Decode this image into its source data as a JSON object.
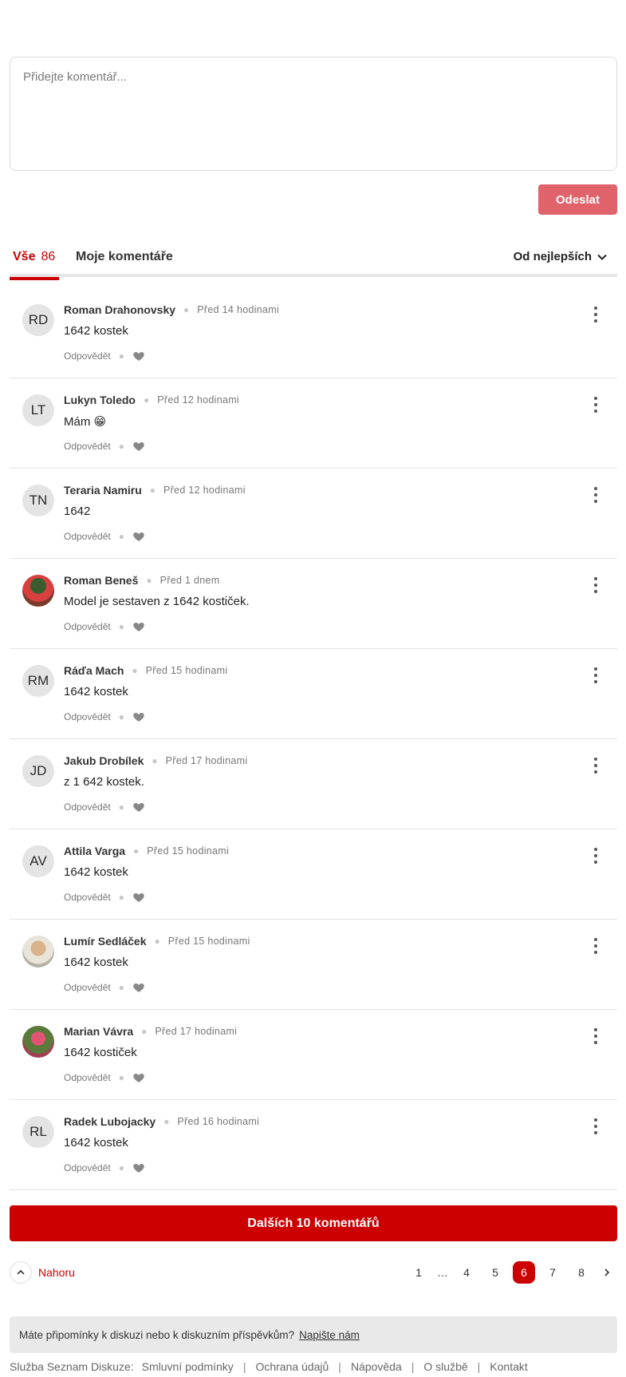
{
  "composer": {
    "placeholder": "Přidejte komentář..."
  },
  "send_label": "Odeslat",
  "tabs": {
    "all_label": "Vše",
    "all_count": "86",
    "mine_label": "Moje komentáře",
    "sort_label": "Od nejlepších"
  },
  "comments": [
    {
      "initials": "RD",
      "name": "Roman Drahonovsky",
      "time": "Před 14 hodinami",
      "text": "1642 kostek",
      "reply": "Odpovědět"
    },
    {
      "initials": "LT",
      "name": "Lukyn Toledo",
      "time": "Před 12 hodinami",
      "text": "Mám 😁",
      "reply": "Odpovědět"
    },
    {
      "initials": "TN",
      "name": "Teraria Namiru",
      "time": "Před 12 hodinami",
      "text": "1642",
      "reply": "Odpovědět"
    },
    {
      "initials": "",
      "name": "Roman Beneš",
      "time": "Před 1 dnem",
      "text": "Model je sestaven z 1642 kostiček.",
      "reply": "Odpovědět"
    },
    {
      "initials": "RM",
      "name": "Ráďa Mach",
      "time": "Před 15 hodinami",
      "text": "1642 kostek",
      "reply": "Odpovědět"
    },
    {
      "initials": "JD",
      "name": "Jakub Drobílek",
      "time": "Před 17 hodinami",
      "text": "z 1 642 kostek.",
      "reply": "Odpovědět"
    },
    {
      "initials": "AV",
      "name": "Attila Varga",
      "time": "Před 15 hodinami",
      "text": "1642 kostek",
      "reply": "Odpovědět"
    },
    {
      "initials": "",
      "name": "Lumír Sedláček",
      "time": "Před 15 hodinami",
      "text": "1642 kostek",
      "reply": "Odpovědět"
    },
    {
      "initials": "",
      "name": "Marian Vávra",
      "time": "Před 17 hodinami",
      "text": "1642 kostiček",
      "reply": "Odpovědět"
    },
    {
      "initials": "RL",
      "name": "Radek Lubojacky",
      "time": "Před 16 hodinami",
      "text": "1642 kostek",
      "reply": "Odpovědět"
    }
  ],
  "load_more_label": "Dalších 10 komentářů",
  "to_top_label": "Nahoru",
  "pagination": {
    "pages": [
      "1",
      "…",
      "4",
      "5",
      "6",
      "7",
      "8"
    ],
    "current": "6"
  },
  "feedback": {
    "text": "Máte připomínky k diskuzi nebo k diskuzním příspěvkům?",
    "link": "Napište nám"
  },
  "footer": {
    "service_label": "Služba Seznam Diskuze:",
    "links": [
      "Smluvní podmínky",
      "Ochrana údajů",
      "Nápověda",
      "O službě",
      "Kontakt"
    ]
  },
  "colors": {
    "accent": "#cc0000",
    "send_button": "#e0626a"
  }
}
